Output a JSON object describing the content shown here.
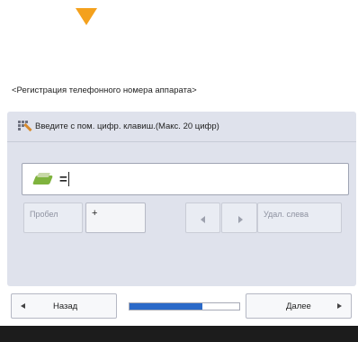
{
  "screen": {
    "title": "<Регистрация телефонного номера аппарата>",
    "indicator_icon": "down-arrow-icon",
    "accent_color": "#f4a11d"
  },
  "panel": {
    "header_text": "Введите с пом. цифр. клавиш.(Макс. 20 цифр)",
    "header_icon": "numeric-keypad-icon"
  },
  "input": {
    "icon": "fax-phone-icon",
    "value": "="
  },
  "keys": {
    "space": "Пробел",
    "plus": "+",
    "cursor_left_icon": "left-arrow-icon",
    "cursor_right_icon": "right-arrow-icon",
    "delete_left": "Удал. слева"
  },
  "nav": {
    "back_label": "Назад",
    "next_label": "Далее",
    "progress_fraction": 0.66,
    "progress_color": "#2a69c8"
  }
}
